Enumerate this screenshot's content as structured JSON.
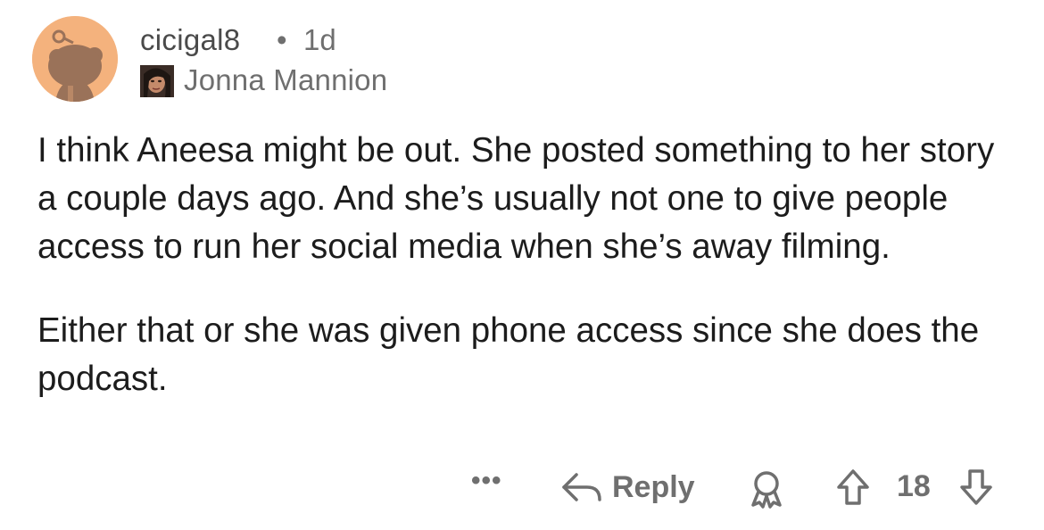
{
  "comment": {
    "author": "cicigal8",
    "separator": "•",
    "age": "1d",
    "flair": "Jonna Mannion",
    "paragraphs": [
      "I think Aneesa might be out. She posted something to her story a couple days ago. And she’s usually not one to give people access to run her social media when she’s away filming.",
      "Either that or she was given phone access since she does the podcast."
    ]
  },
  "actions": {
    "more": "•••",
    "reply_label": "Reply",
    "score": "18"
  },
  "icons": {
    "avatar": "reddit-snoo-avatar",
    "flair_image": "user-flair-photo",
    "reply": "reply-arrow-icon",
    "award": "award-icon",
    "upvote": "upvote-arrow-icon",
    "downvote": "downvote-arrow-icon"
  },
  "colors": {
    "avatar_background": "#f4b27d",
    "muted_text": "#6f6f6f",
    "body_text": "#1c1c1c"
  }
}
